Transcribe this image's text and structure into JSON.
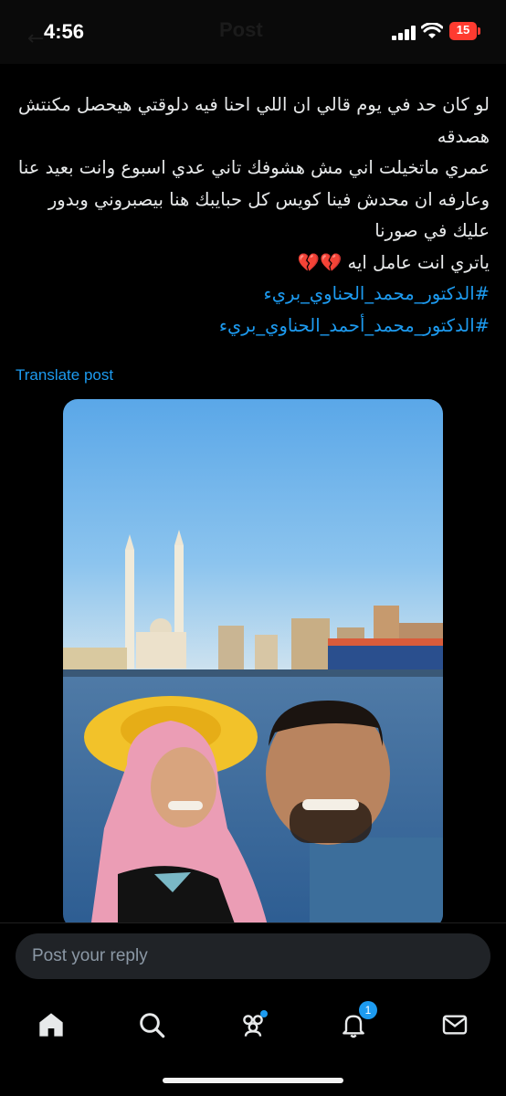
{
  "status_bar": {
    "time": "4:56",
    "battery": "15",
    "ghost_title": "Post",
    "battery_color": "#ff3b30"
  },
  "post": {
    "lines": [
      "لو كان حد في يوم قالي ان اللي احنا فيه دلوقتي هيحصل مكنتش هصدقه",
      "عمري ماتخيلت اني مش هشوفك تاني عدي اسبوع وانت بعيد عنا وعارفه ان محدش فينا كويس كل حبايبك هنا بيصبروني وبدور عليك في صورنا",
      "ياتري انت عامل ايه 💔💔"
    ],
    "hashtags": [
      "#الدكتور_محمد_الحناوي_بريء",
      "#الدكتور_محمد_أحمد_الحناوي_بريء"
    ],
    "translate_label": "Translate post",
    "link_color": "#1d9bf0"
  },
  "photo": {
    "icon": "photo-of-couple-by-river"
  },
  "reply": {
    "placeholder": "Post your reply"
  },
  "nav": {
    "items": [
      {
        "name": "home",
        "icon": "home-icon"
      },
      {
        "name": "search",
        "icon": "search-icon"
      },
      {
        "name": "communities",
        "icon": "communities-icon"
      },
      {
        "name": "notifications",
        "icon": "bell-icon",
        "badge": "1"
      },
      {
        "name": "messages",
        "icon": "mail-icon"
      }
    ]
  }
}
